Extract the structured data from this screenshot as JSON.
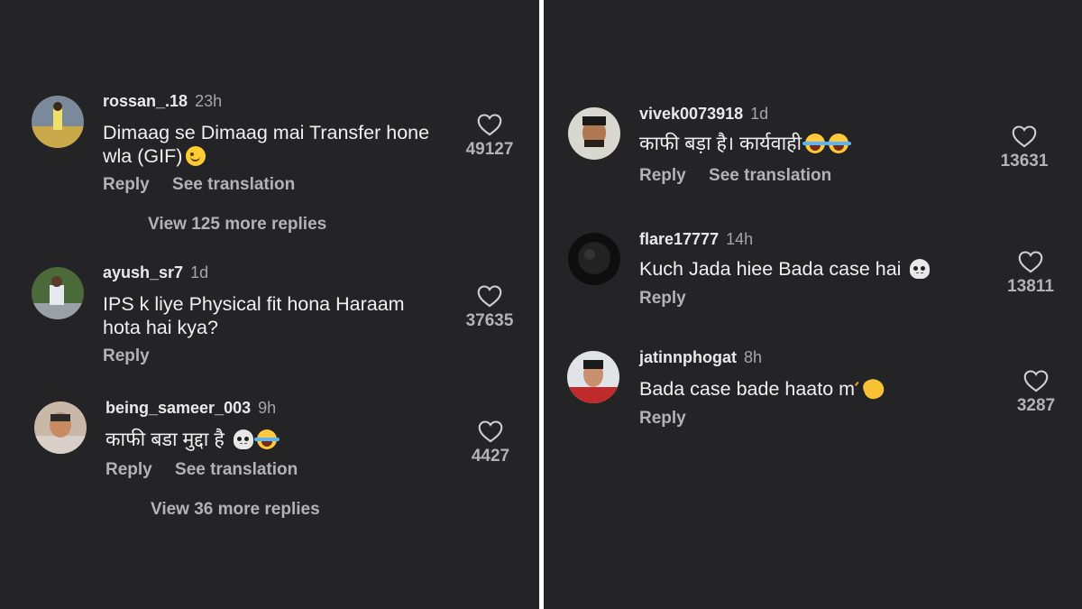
{
  "reply_label": "Reply",
  "see_translation_label": "See translation",
  "left_comments": [
    {
      "username": "rossan_.18",
      "time": "23h",
      "text": "Dimaag se Dimaag mai Transfer hone wla (GIF)",
      "emoji": "winking-face",
      "likes": "49127",
      "more_replies": "View 125 more replies"
    },
    {
      "username": "ayush_sr7",
      "time": "1d",
      "text": "IPS k liye Physical fit hona Haraam hota hai kya?",
      "likes": "37635"
    },
    {
      "username": "being_sameer_003",
      "time": "9h",
      "text": "काफी बडा मुद्दा है",
      "emoji": "skull, face-with-tears-of-joy",
      "likes": "4427",
      "more_replies": "View 36 more replies"
    }
  ],
  "right_comments": [
    {
      "username": "vivek0073918",
      "time": "1d",
      "text": "काफी बड़ा है। कार्यवाही",
      "emoji": "face-with-tears-of-joy x2",
      "likes": "13631"
    },
    {
      "username": "flare17777",
      "time": "14h",
      "text": "Kuch Jada hiee Bada case hai",
      "emoji": "skull",
      "likes": "13811"
    },
    {
      "username": "jatinnphogat",
      "time": "8h",
      "text": "Bada case bade haato m",
      "emoji": "clapping-hands",
      "likes": "3287"
    }
  ],
  "icons": {
    "like": "heart-outline-icon"
  },
  "colors": {
    "background": "#242427",
    "divider": "#ffffff",
    "primary_text": "#f0f0f0",
    "secondary_text": "#b3b3b3"
  }
}
